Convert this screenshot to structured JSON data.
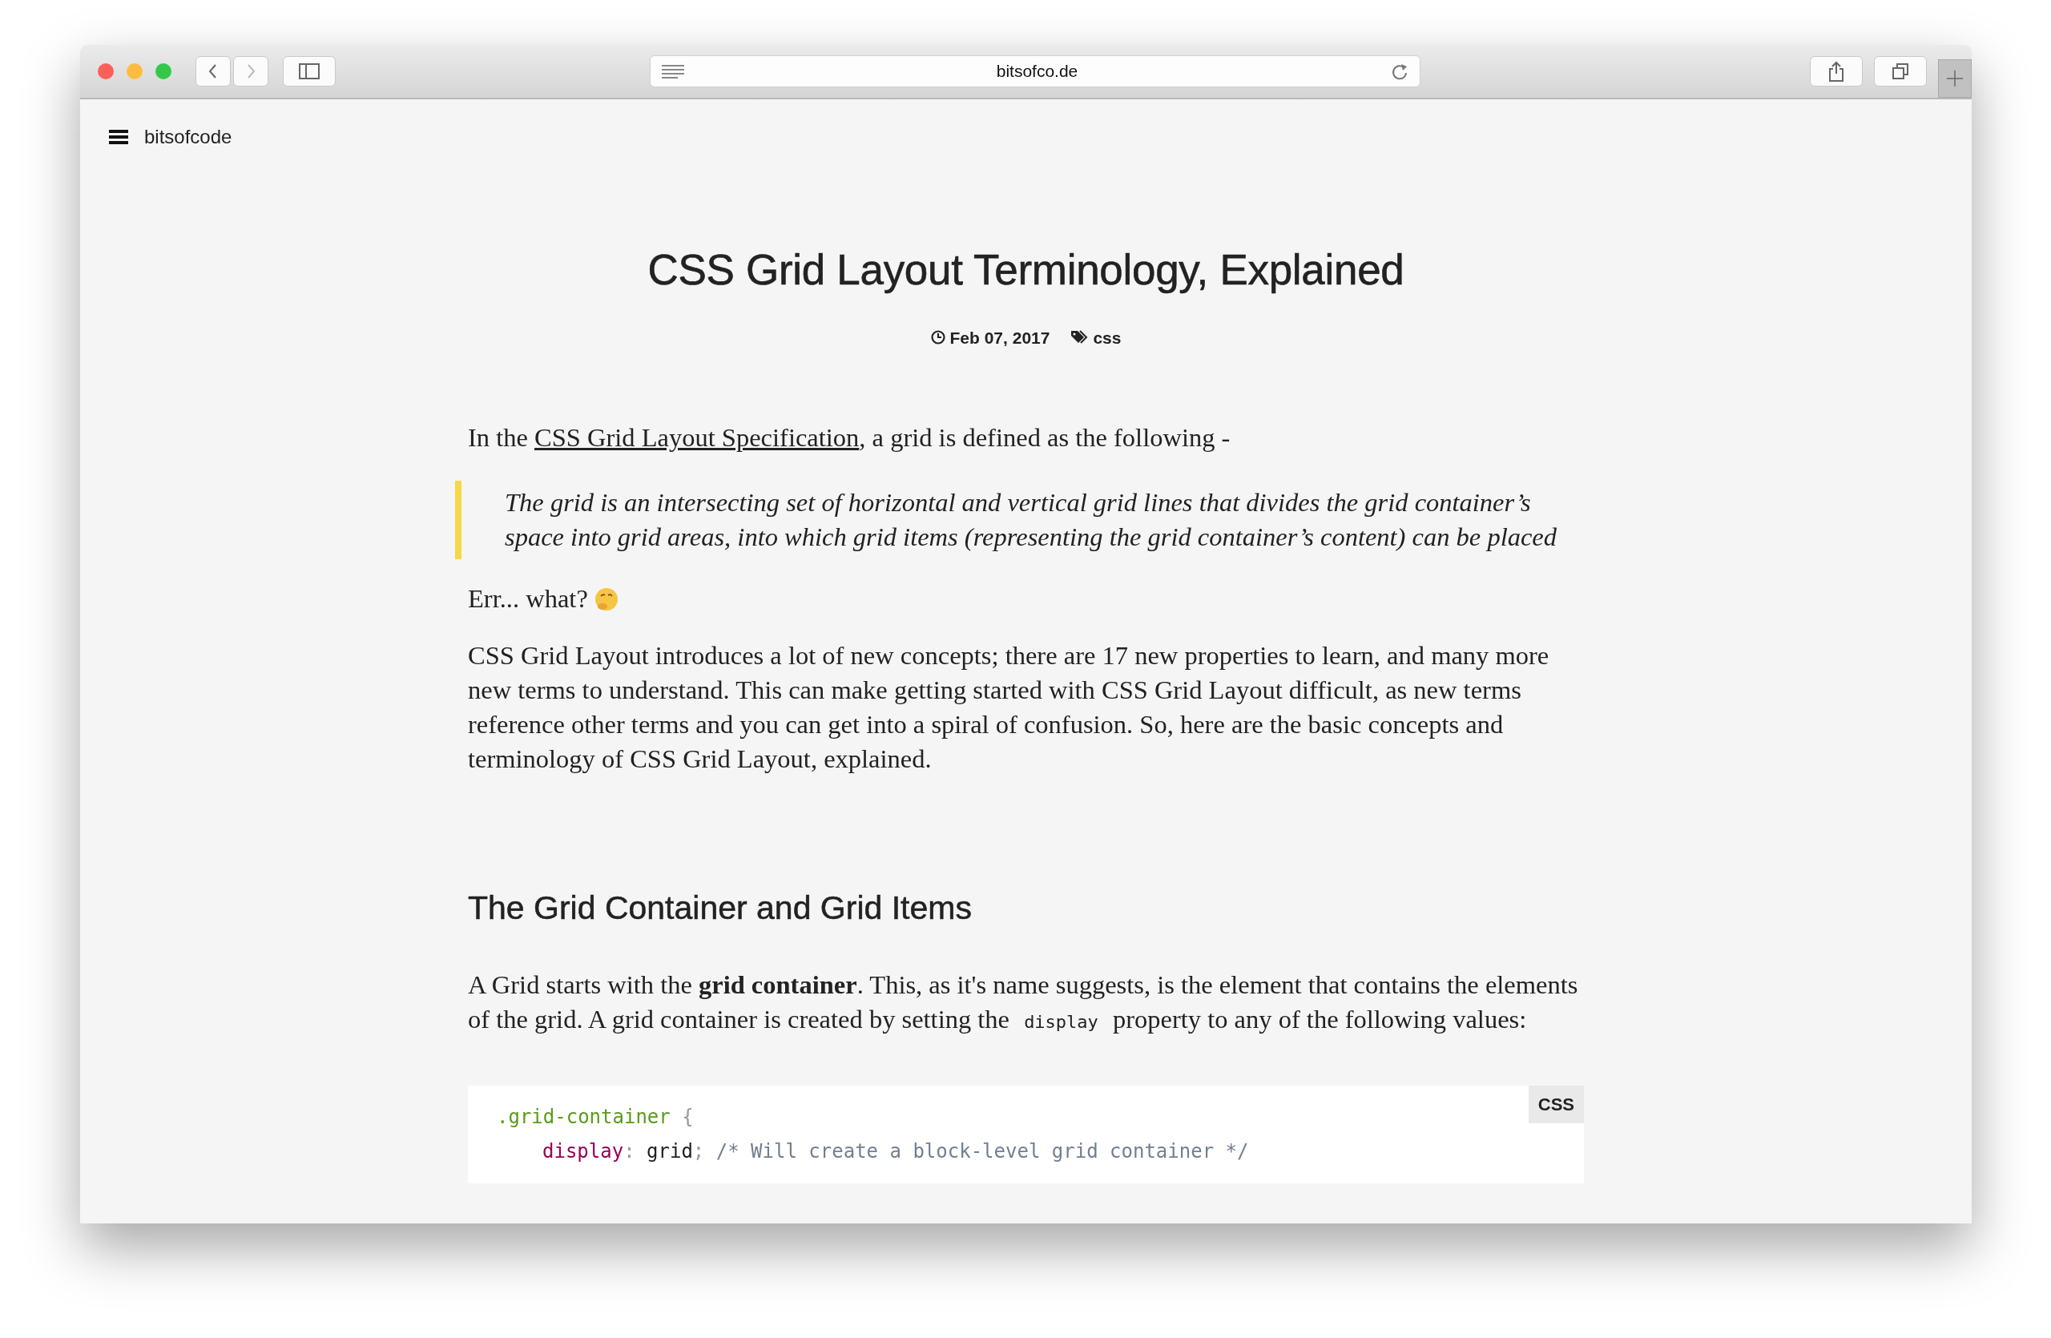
{
  "browser": {
    "traffic_lights": [
      {
        "color": "#fc605b"
      },
      {
        "color": "#fdbc40"
      },
      {
        "color": "#34c84a"
      }
    ],
    "nav_buttons": [
      {
        "kind": "back",
        "disabled": false
      },
      {
        "kind": "forward",
        "disabled": true
      }
    ],
    "address": "bitsofco.de"
  },
  "site": {
    "name": "bitsofcode"
  },
  "article": {
    "title": "CSS Grid Layout Terminology, Explained",
    "date": "Feb 07, 2017",
    "tags": [
      "css"
    ],
    "blocks": [
      {
        "kind": "paragraph",
        "parts": [
          {
            "kind": "text",
            "text": "In the "
          },
          {
            "kind": "link",
            "text": "CSS Grid Layout Specification"
          },
          {
            "kind": "text",
            "text": ", a grid is defined as the following -"
          }
        ]
      },
      {
        "kind": "quote",
        "text": "The grid is an intersecting set of horizontal and vertical grid lines that divides the grid container’s space into grid areas, into which grid items (representing the grid container’s content) can be placed"
      },
      {
        "kind": "paragraph",
        "parts": [
          {
            "kind": "text",
            "text": "Err... what? "
          },
          {
            "kind": "emoji"
          }
        ]
      },
      {
        "kind": "paragraph",
        "parts": [
          {
            "kind": "text",
            "text": "CSS Grid Layout introduces a lot of new concepts; there are 17 new properties to learn, and many more new terms to understand. This can make getting started with CSS Grid Layout difficult, as new terms reference other terms and you can get into a spiral of confusion. So, here are the basic concepts and terminology of CSS Grid Layout, explained."
          }
        ]
      },
      {
        "kind": "heading",
        "text": "The Grid Container and Grid Items"
      },
      {
        "kind": "paragraph",
        "parts": [
          {
            "kind": "text",
            "text": "A Grid starts with the **grid container**. This, as it's name suggests, is the element that contains the elements of the grid. A grid container is created by setting the "
          },
          {
            "kind": "code",
            "text": "display"
          },
          {
            "kind": "text",
            "text": " property to any of the following values:"
          }
        ]
      },
      {
        "kind": "code",
        "language": "CSS",
        "lines": [
          {
            "indented": false,
            "tokens": [
              {
                "kind": "selector",
                "text": ".grid-container"
              },
              {
                "kind": "punct",
                "text": " {"
              }
            ]
          },
          {
            "indented": true,
            "tokens": [
              {
                "kind": "property",
                "text": "display"
              },
              {
                "kind": "punct",
                "text": ": "
              },
              {
                "kind": "value",
                "text": "grid"
              },
              {
                "kind": "punct",
                "text": "; "
              },
              {
                "kind": "comment",
                "text": "/* Will create a block-level grid container */"
              }
            ]
          }
        ]
      }
    ]
  }
}
